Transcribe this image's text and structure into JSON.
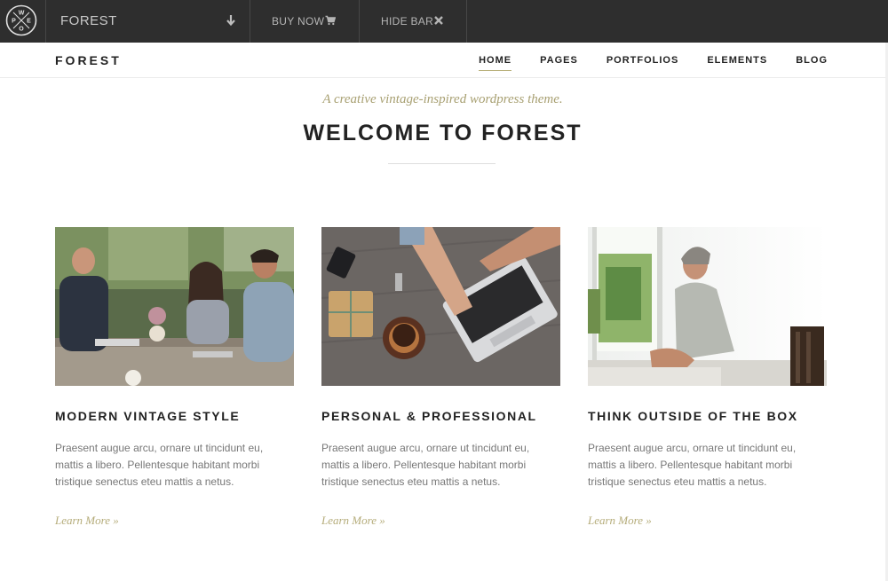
{
  "topbar": {
    "logo_letters": [
      "W",
      "P",
      "E",
      "O"
    ],
    "theme_name": "FOREST",
    "buy_label": "BUY NOW",
    "hide_label": "HIDE BAR"
  },
  "nav": {
    "brand": "FOREST",
    "items": [
      {
        "label": "HOME",
        "active": true
      },
      {
        "label": "PAGES",
        "active": false
      },
      {
        "label": "PORTFOLIOS",
        "active": false
      },
      {
        "label": "ELEMENTS",
        "active": false
      },
      {
        "label": "BLOG",
        "active": false
      }
    ]
  },
  "hero": {
    "tagline": "A creative vintage-inspired wordpress theme.",
    "title": "WELCOME TO FOREST"
  },
  "cards": [
    {
      "title": "MODERN VINTAGE STYLE",
      "text": "Praesent augue arcu, ornare ut tincidunt eu, mattis a libero. Pellentesque habitant morbi tristique senectus eteu mattis a netus.",
      "link": "Learn More »"
    },
    {
      "title": "PERSONAL & PROFESSIONAL",
      "text": "Praesent augue arcu, ornare ut tincidunt eu, mattis a libero. Pellentesque habitant morbi tristique senectus eteu mattis a netus.",
      "link": "Learn More »"
    },
    {
      "title": "THINK OUTSIDE OF THE BOX",
      "text": "Praesent augue arcu, ornare ut tincidunt eu, mattis a libero. Pellentesque habitant morbi tristique senectus eteu mattis a netus.",
      "link": "Learn More »"
    }
  ],
  "colors": {
    "topbar_bg": "#2e2e2e",
    "accent": "#b5ac7a",
    "heading": "#222222",
    "body_text": "#777777"
  }
}
